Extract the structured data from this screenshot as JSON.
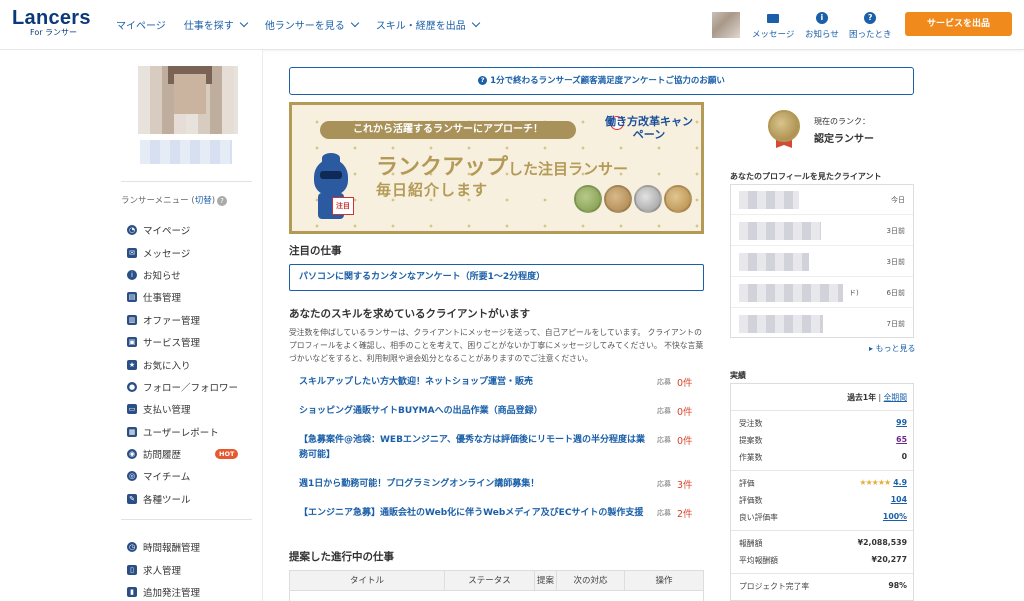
{
  "header": {
    "logo_main": "Lancers",
    "logo_sub": "For ランサー",
    "nav": [
      {
        "label": "マイページ",
        "caret": false
      },
      {
        "label": "仕事を探す",
        "caret": true
      },
      {
        "label": "他ランサーを見る",
        "caret": true
      },
      {
        "label": "スキル・経歴を出品",
        "caret": true
      }
    ],
    "icons": [
      {
        "label": "メッセージ",
        "icon": "envelope-icon"
      },
      {
        "label": "お知らせ",
        "icon": "info-icon"
      },
      {
        "label": "困ったとき",
        "icon": "help-icon"
      }
    ],
    "service_button": "サービスを出品"
  },
  "sidebar": {
    "menu_heading": "ランサーメニュー (",
    "menu_switch": "切替",
    "menu_heading_end": ")",
    "menu_items": [
      {
        "label": "マイページ",
        "icon": "dashboard-icon",
        "glyph": "◔"
      },
      {
        "label": "メッセージ",
        "icon": "envelope-icon",
        "glyph": "✉"
      },
      {
        "label": "お知らせ",
        "icon": "info-icon",
        "glyph": "i"
      },
      {
        "label": "仕事管理",
        "icon": "briefcase-icon",
        "glyph": "▤"
      },
      {
        "label": "オファー管理",
        "icon": "offer-icon",
        "glyph": "▥"
      },
      {
        "label": "サービス管理",
        "icon": "service-icon",
        "glyph": "▣"
      },
      {
        "label": "お気に入り",
        "icon": "star-icon",
        "glyph": "★"
      },
      {
        "label": "フォロー／フォロワー",
        "icon": "user-icon",
        "glyph": "●"
      },
      {
        "label": "支払い管理",
        "icon": "card-icon",
        "glyph": "▭"
      },
      {
        "label": "ユーザーレポート",
        "icon": "report-icon",
        "glyph": "▦"
      },
      {
        "label": "訪問履歴",
        "icon": "footprint-icon",
        "glyph": "◉",
        "badge": "HOT"
      },
      {
        "label": "マイチーム",
        "icon": "team-icon",
        "glyph": "◎"
      },
      {
        "label": "各種ツール",
        "icon": "wrench-icon",
        "glyph": "✎"
      }
    ],
    "menu_items2": [
      {
        "label": "時間報酬管理",
        "icon": "clock-icon",
        "glyph": "◷"
      },
      {
        "label": "求人管理",
        "icon": "document-icon",
        "glyph": "▯"
      },
      {
        "label": "追加発注管理",
        "icon": "add-order-icon",
        "glyph": "▮"
      }
    ]
  },
  "main": {
    "survey_text": "1分で終わるランサーズ顧客満足度アンケートご協力のお願い",
    "banner": {
      "pill": "これから活躍するランサーにアプローチ！",
      "campaign": "働き方改革キャンペーン",
      "rank_big": "ランクアップ",
      "rank_small": "した注目ランサー",
      "daily": "毎日紹介します",
      "sign": "注目"
    },
    "featured_title": "注目の仕事",
    "featured_job": "パソコンに関するカンタンなアンケート（所要1〜2分程度）",
    "skill_title": "あなたのスキルを求めているクライアントがいます",
    "skill_desc": "受注数を伸ばしているランサーは、クライアントにメッセージを送って、自己アピールをしています。 クライアントのプロフィールをよく確認し、相手のことを考えて、困りごとがないか丁寧にメッセージしてみてください。 不快な言葉づかいなどをすると、利用制限や退会処分となることがありますのでご注意ください。",
    "apply_label": "応募",
    "jobs": [
      {
        "title": "スキルアップしたい方大歓迎！ネットショップ運営・販売",
        "count": "0件"
      },
      {
        "title": "ショッピング通販サイトBUYMAへの出品作業（商品登録）",
        "count": "0件"
      },
      {
        "title": "【急募案件@池袋：WEBエンジニア、優秀な方は評価後にリモート週の半分程度は業務可能】",
        "count": "0件"
      },
      {
        "title": "週1日から勤務可能！プログラミングオンライン講師募集！",
        "count": "3件"
      },
      {
        "title": "【エンジニア急募】通販会社のWeb化に伴うWebメディア及びECサイトの製作支援",
        "count": "2件"
      }
    ],
    "progress_title": "提案した進行中の仕事",
    "table_headers": [
      "タイトル",
      "ステータス",
      "提案",
      "次の対応",
      "操作"
    ]
  },
  "right": {
    "rank_label": "現在のランク：",
    "rank_value": "認定ランサー",
    "visitors_title": "あなたのプロフィールを見たクライアント",
    "visitors": [
      {
        "when": "今日",
        "tail": ""
      },
      {
        "when": "3日前",
        "tail": ""
      },
      {
        "when": "3日前",
        "tail": ""
      },
      {
        "when": "6日前",
        "tail": "ド)"
      },
      {
        "when": "7日前",
        "tail": ""
      }
    ],
    "more": "▸ もっと見る",
    "stats_title": "実績",
    "period_past": "過去1年",
    "period_sep": " | ",
    "period_all": "全期間",
    "stats": [
      {
        "k": "受注数",
        "v": "99",
        "style": "link"
      },
      {
        "k": "提案数",
        "v": "65",
        "style": "link2"
      },
      {
        "k": "作業数",
        "v": "0",
        "style": "plain"
      },
      {
        "k": "評価",
        "v": "4.9",
        "style": "link",
        "stars": "★★★★★"
      },
      {
        "k": "評価数",
        "v": "104",
        "style": "link"
      },
      {
        "k": "良い評価率",
        "v": "100%",
        "style": "link"
      },
      {
        "k": "報酬額",
        "v": "¥2,088,539",
        "style": "plain"
      },
      {
        "k": "平均報酬額",
        "v": "¥20,277",
        "style": "plain"
      },
      {
        "k": "プロジェクト完了率",
        "v": "98%",
        "style": "plain"
      }
    ],
    "rating_value": 4.9
  }
}
